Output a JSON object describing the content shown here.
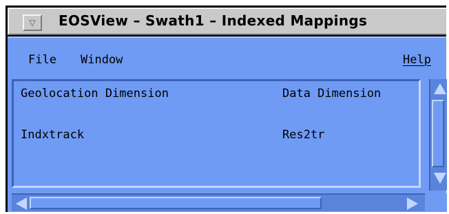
{
  "window": {
    "title": "EOSView – Swath1 – Indexed Mappings",
    "menu_button_icon": "down-triangle-icon"
  },
  "menubar": {
    "items": [
      {
        "label": "File"
      },
      {
        "label": "Window"
      },
      {
        "label": "Help"
      }
    ]
  },
  "table": {
    "headers": [
      "Geolocation Dimension",
      "Data Dimension"
    ],
    "rows": [
      [
        "Indxtrack",
        "Res2tr"
      ]
    ]
  },
  "colors": {
    "background": "#6f9bf4",
    "titlebar": "#c9c9c9",
    "scroll_trough": "#5a84dc"
  },
  "scrollbars": {
    "vertical_icons": [
      "up-arrow-icon",
      "down-arrow-icon"
    ],
    "horizontal_icons": [
      "left-arrow-icon",
      "right-arrow-icon"
    ]
  }
}
